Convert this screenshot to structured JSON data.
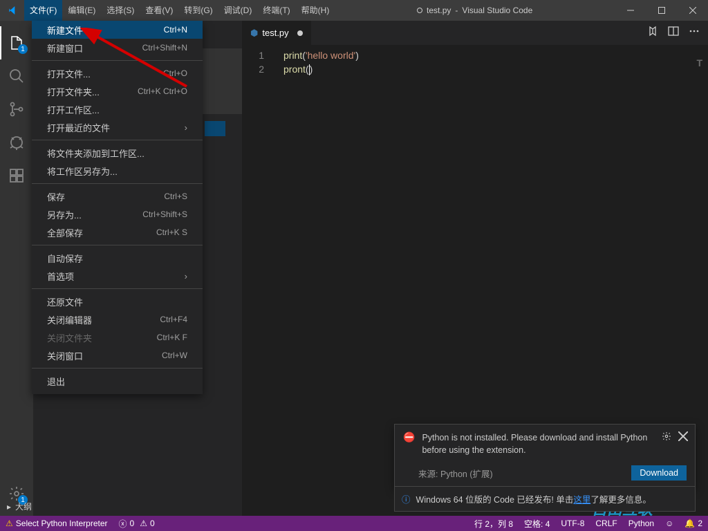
{
  "titlebar": {
    "menus": [
      "文件(F)",
      "编辑(E)",
      "选择(S)",
      "查看(V)",
      "转到(G)",
      "调试(D)",
      "终端(T)",
      "帮助(H)"
    ],
    "title_file": "test.py",
    "title_app": "Visual Studio Code"
  },
  "dropdown": {
    "items": [
      {
        "label": "新建文件",
        "shortcut": "Ctrl+N",
        "hover": true
      },
      {
        "label": "新建窗口",
        "shortcut": "Ctrl+Shift+N"
      },
      {
        "sep": true
      },
      {
        "label": "打开文件...",
        "shortcut": "Ctrl+O"
      },
      {
        "label": "打开文件夹...",
        "shortcut": "Ctrl+K Ctrl+O"
      },
      {
        "label": "打开工作区..."
      },
      {
        "label": "打开最近的文件",
        "chev": true
      },
      {
        "sep": true
      },
      {
        "label": "将文件夹添加到工作区..."
      },
      {
        "label": "将工作区另存为..."
      },
      {
        "sep": true
      },
      {
        "label": "保存",
        "shortcut": "Ctrl+S"
      },
      {
        "label": "另存为...",
        "shortcut": "Ctrl+Shift+S"
      },
      {
        "label": "全部保存",
        "shortcut": "Ctrl+K S"
      },
      {
        "sep": true
      },
      {
        "label": "自动保存"
      },
      {
        "label": "首选项",
        "chev": true
      },
      {
        "sep": true
      },
      {
        "label": "还原文件"
      },
      {
        "label": "关闭编辑器",
        "shortcut": "Ctrl+F4"
      },
      {
        "label": "关闭文件夹",
        "shortcut": "Ctrl+K F",
        "disabled": true
      },
      {
        "label": "关闭窗口",
        "shortcut": "Ctrl+W"
      },
      {
        "sep": true
      },
      {
        "label": "退出"
      }
    ]
  },
  "activitybar": {
    "badge_explorer": "1",
    "badge_settings": "1"
  },
  "tab": {
    "filename": "test.py"
  },
  "editor": {
    "lines": [
      {
        "num": "1",
        "fn": "print",
        "str": "'hello world'"
      },
      {
        "num": "2",
        "fn": "pront",
        "str": ""
      }
    ]
  },
  "sidebar": {
    "outline_label": "大纲"
  },
  "notif1": {
    "msg": "Python is not installed. Please download and install Python before using the extension.",
    "source": "来源: Python (扩展)",
    "download": "Download"
  },
  "notif2": {
    "prefix": "Windows 64 位版的 Code 已经发布! 单击",
    "link": "这里",
    "suffix": "了解更多信息。"
  },
  "statusbar": {
    "interpreter": "Select Python Interpreter",
    "errors": "0",
    "warnings": "0",
    "lncol": "行 2，列 8",
    "spaces": "空格: 4",
    "encoding": "UTF-8",
    "eol": "CRLF",
    "lang": "Python",
    "bell": "2"
  },
  "watermark": {
    "text": "自由互联"
  }
}
